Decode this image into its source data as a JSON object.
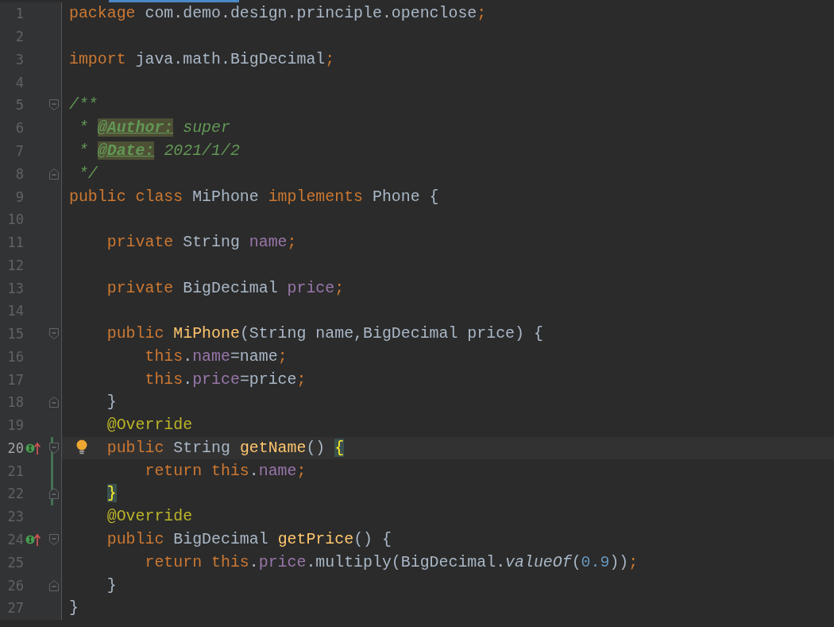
{
  "editor": {
    "lines": [
      {
        "number": "1",
        "current": false,
        "vcs_changed": false,
        "bulb": false,
        "implements_marker": false,
        "fold_start": false,
        "fold_end": false,
        "tokens": [
          {
            "kind": "keyword",
            "text": "package"
          },
          {
            "kind": "plain",
            "text": " com.demo.design.principle.openclose"
          },
          {
            "kind": "keyword",
            "text": ";"
          }
        ]
      },
      {
        "number": "2",
        "current": false,
        "vcs_changed": false,
        "bulb": false,
        "implements_marker": false,
        "fold_start": false,
        "fold_end": false
      },
      {
        "number": "3",
        "current": false,
        "vcs_changed": false,
        "bulb": false,
        "implements_marker": false,
        "fold_start": false,
        "fold_end": false,
        "tokens": [
          {
            "kind": "keyword",
            "text": "import"
          },
          {
            "kind": "plain",
            "text": " java.math.BigDecimal"
          },
          {
            "kind": "keyword",
            "text": ";"
          }
        ]
      },
      {
        "number": "4",
        "current": false,
        "vcs_changed": false,
        "bulb": false,
        "implements_marker": false,
        "fold_start": false,
        "fold_end": false
      },
      {
        "number": "5",
        "current": false,
        "vcs_changed": false,
        "bulb": false,
        "implements_marker": false,
        "fold_start": true,
        "fold_end": false,
        "tokens": [
          {
            "kind": "comment",
            "text": "/**"
          }
        ]
      },
      {
        "number": "6",
        "current": false,
        "vcs_changed": false,
        "bulb": false,
        "implements_marker": false,
        "fold_start": false,
        "fold_end": false,
        "tokens": [
          {
            "kind": "comment",
            "text": " * "
          },
          {
            "kind": "doctag",
            "text": "@Author:"
          },
          {
            "kind": "comment",
            "text": " super"
          }
        ]
      },
      {
        "number": "7",
        "current": false,
        "vcs_changed": false,
        "bulb": false,
        "implements_marker": false,
        "fold_start": false,
        "fold_end": false,
        "tokens": [
          {
            "kind": "comment",
            "text": " * "
          },
          {
            "kind": "doctag",
            "text": "@Date:"
          },
          {
            "kind": "comment",
            "text": " 2021/1/2"
          }
        ]
      },
      {
        "number": "8",
        "current": false,
        "vcs_changed": false,
        "bulb": false,
        "implements_marker": false,
        "fold_start": false,
        "fold_end": true,
        "tokens": [
          {
            "kind": "comment",
            "text": " */"
          }
        ]
      },
      {
        "number": "9",
        "current": false,
        "vcs_changed": false,
        "bulb": false,
        "implements_marker": false,
        "fold_start": false,
        "fold_end": false,
        "tokens": [
          {
            "kind": "keyword",
            "text": "public class "
          },
          {
            "kind": "plain",
            "text": "MiPhone "
          },
          {
            "kind": "keyword",
            "text": "implements "
          },
          {
            "kind": "plain",
            "text": "Phone {"
          }
        ]
      },
      {
        "number": "10",
        "current": false,
        "vcs_changed": false,
        "bulb": false,
        "implements_marker": false,
        "fold_start": false,
        "fold_end": false
      },
      {
        "number": "11",
        "current": false,
        "vcs_changed": false,
        "bulb": false,
        "implements_marker": false,
        "fold_start": false,
        "fold_end": false,
        "tokens": [
          {
            "kind": "keyword",
            "text": "    private "
          },
          {
            "kind": "plain",
            "text": "String "
          },
          {
            "kind": "field",
            "text": "name"
          },
          {
            "kind": "keyword",
            "text": ";"
          }
        ]
      },
      {
        "number": "12",
        "current": false,
        "vcs_changed": false,
        "bulb": false,
        "implements_marker": false,
        "fold_start": false,
        "fold_end": false
      },
      {
        "number": "13",
        "current": false,
        "vcs_changed": false,
        "bulb": false,
        "implements_marker": false,
        "fold_start": false,
        "fold_end": false,
        "tokens": [
          {
            "kind": "keyword",
            "text": "    private "
          },
          {
            "kind": "plain",
            "text": "BigDecimal "
          },
          {
            "kind": "field",
            "text": "price"
          },
          {
            "kind": "keyword",
            "text": ";"
          }
        ]
      },
      {
        "number": "14",
        "current": false,
        "vcs_changed": false,
        "bulb": false,
        "implements_marker": false,
        "fold_start": false,
        "fold_end": false
      },
      {
        "number": "15",
        "current": false,
        "vcs_changed": false,
        "bulb": false,
        "implements_marker": false,
        "fold_start": true,
        "fold_end": false,
        "tokens": [
          {
            "kind": "keyword",
            "text": "    public "
          },
          {
            "kind": "method-decl",
            "text": "MiPhone"
          },
          {
            "kind": "plain",
            "text": "(String name,BigDecimal price) {"
          }
        ]
      },
      {
        "number": "16",
        "current": false,
        "vcs_changed": false,
        "bulb": false,
        "implements_marker": false,
        "fold_start": false,
        "fold_end": false,
        "tokens": [
          {
            "kind": "keyword",
            "text": "        this"
          },
          {
            "kind": "plain",
            "text": "."
          },
          {
            "kind": "field",
            "text": "name"
          },
          {
            "kind": "plain",
            "text": "=name"
          },
          {
            "kind": "keyword",
            "text": ";"
          }
        ]
      },
      {
        "number": "17",
        "current": false,
        "vcs_changed": false,
        "bulb": false,
        "implements_marker": false,
        "fold_start": false,
        "fold_end": false,
        "tokens": [
          {
            "kind": "keyword",
            "text": "        this"
          },
          {
            "kind": "plain",
            "text": "."
          },
          {
            "kind": "field",
            "text": "price"
          },
          {
            "kind": "plain",
            "text": "=price"
          },
          {
            "kind": "keyword",
            "text": ";"
          }
        ]
      },
      {
        "number": "18",
        "current": false,
        "vcs_changed": false,
        "bulb": false,
        "implements_marker": false,
        "fold_start": false,
        "fold_end": true,
        "tokens": [
          {
            "kind": "plain",
            "text": "    }"
          }
        ]
      },
      {
        "number": "19",
        "current": false,
        "vcs_changed": false,
        "bulb": false,
        "implements_marker": false,
        "fold_start": false,
        "fold_end": false,
        "tokens": [
          {
            "kind": "annotation",
            "text": "    @Override"
          }
        ]
      },
      {
        "number": "20",
        "current": true,
        "vcs_changed": true,
        "bulb": true,
        "implements_marker": true,
        "fold_start": true,
        "fold_end": false,
        "tokens": [
          {
            "kind": "keyword",
            "text": "    public "
          },
          {
            "kind": "plain",
            "text": "String "
          },
          {
            "kind": "method-decl",
            "text": "getName"
          },
          {
            "kind": "plain",
            "text": "() "
          },
          {
            "kind": "matched-brace",
            "text": "{"
          }
        ]
      },
      {
        "number": "21",
        "current": false,
        "vcs_changed": true,
        "bulb": false,
        "implements_marker": false,
        "fold_start": false,
        "fold_end": false,
        "tokens": [
          {
            "kind": "keyword",
            "text": "        return this"
          },
          {
            "kind": "plain",
            "text": "."
          },
          {
            "kind": "field",
            "text": "name"
          },
          {
            "kind": "keyword",
            "text": ";"
          }
        ]
      },
      {
        "number": "22",
        "current": false,
        "vcs_changed": true,
        "bulb": false,
        "implements_marker": false,
        "fold_start": false,
        "fold_end": true,
        "tokens": [
          {
            "kind": "matched-brace",
            "text": "    }"
          }
        ]
      },
      {
        "number": "23",
        "current": false,
        "vcs_changed": false,
        "bulb": false,
        "implements_marker": false,
        "fold_start": false,
        "fold_end": false,
        "tokens": [
          {
            "kind": "annotation",
            "text": "    @Override"
          }
        ]
      },
      {
        "number": "24",
        "current": false,
        "vcs_changed": false,
        "bulb": false,
        "implements_marker": true,
        "fold_start": true,
        "fold_end": false,
        "tokens": [
          {
            "kind": "keyword",
            "text": "    public "
          },
          {
            "kind": "plain",
            "text": "BigDecimal "
          },
          {
            "kind": "method-decl",
            "text": "getPrice"
          },
          {
            "kind": "plain",
            "text": "() {"
          }
        ]
      },
      {
        "number": "25",
        "current": false,
        "vcs_changed": false,
        "bulb": false,
        "implements_marker": false,
        "fold_start": false,
        "fold_end": false,
        "tokens": [
          {
            "kind": "keyword",
            "text": "        return this"
          },
          {
            "kind": "plain",
            "text": "."
          },
          {
            "kind": "field",
            "text": "price"
          },
          {
            "kind": "plain",
            "text": ".multiply(BigDecimal."
          },
          {
            "kind": "static-call",
            "text": "valueOf"
          },
          {
            "kind": "plain",
            "text": "("
          },
          {
            "kind": "number",
            "text": "0.9"
          },
          {
            "kind": "plain",
            "text": "))"
          },
          {
            "kind": "keyword",
            "text": ";"
          }
        ]
      },
      {
        "number": "26",
        "current": false,
        "vcs_changed": false,
        "bulb": false,
        "implements_marker": false,
        "fold_start": false,
        "fold_end": true,
        "tokens": [
          {
            "kind": "plain",
            "text": "    }"
          }
        ]
      },
      {
        "number": "27",
        "current": false,
        "vcs_changed": false,
        "bulb": false,
        "implements_marker": false,
        "fold_start": false,
        "fold_end": false,
        "tokens": [
          {
            "kind": "plain",
            "text": "}"
          }
        ]
      }
    ]
  }
}
